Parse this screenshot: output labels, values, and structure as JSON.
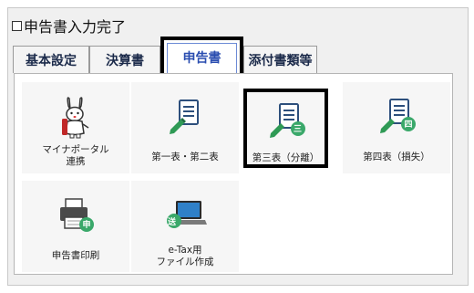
{
  "header": {
    "completed_label": "申告書入力完了"
  },
  "tabs": [
    {
      "label": "基本設定"
    },
    {
      "label": "決算書"
    },
    {
      "label": "申告書"
    },
    {
      "label": "添付書類等"
    }
  ],
  "tiles": [
    {
      "label": "マイナポータル\n連携",
      "icon": "rabbit-mascot-icon"
    },
    {
      "label": "第一表・第二表",
      "icon": "document-pen-icon"
    },
    {
      "label": "第三表（分離）",
      "icon": "document-pen-icon",
      "badge": "三"
    },
    {
      "label": "第四表（損失）",
      "icon": "document-pen-icon",
      "badge": "四"
    },
    {
      "label": "申告書印刷",
      "icon": "printer-icon",
      "badge": "申"
    },
    {
      "label": "e-Tax用\nファイル作成",
      "icon": "laptop-icon",
      "badge": "送"
    }
  ],
  "colors": {
    "badge_green": "#3aa86a",
    "pen_green": "#2f9a55",
    "doc_blue": "#2d4f7c",
    "accent": "#2a4db0"
  }
}
